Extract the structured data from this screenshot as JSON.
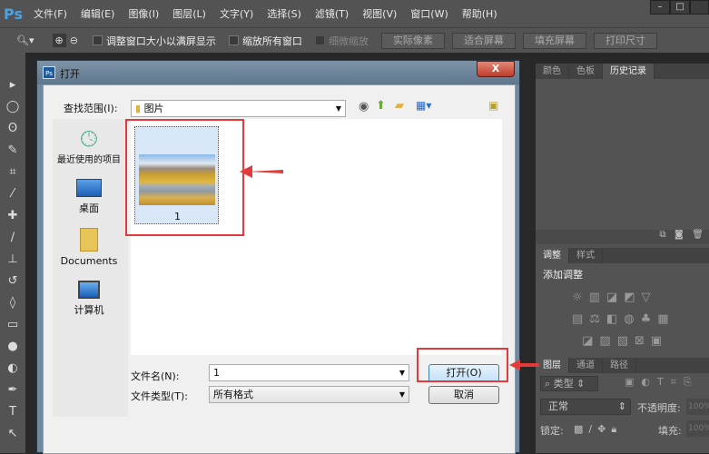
{
  "app": {
    "logo": "Ps",
    "menus": [
      "文件(F)",
      "编辑(E)",
      "图像(I)",
      "图层(L)",
      "文字(Y)",
      "选择(S)",
      "滤镜(T)",
      "视图(V)",
      "窗口(W)",
      "帮助(H)"
    ]
  },
  "options": {
    "resize_windows": "调整窗口大小以满屏显示",
    "zoom_all": "缩放所有窗口",
    "scrubby": "细微缩放",
    "actual_pixels": "实际像素",
    "fit_screen": "适合屏幕",
    "fill_screen": "填充屏幕",
    "print_size": "打印尺寸"
  },
  "panels": {
    "top_tabs": [
      "颜色",
      "色板",
      "历史记录"
    ],
    "adjust_tabs": [
      "调整",
      "样式"
    ],
    "add_adjustment": "添加调整",
    "layer_tabs": [
      "图层",
      "通道",
      "路径"
    ],
    "kind": "类型",
    "blend_mode": "正常",
    "opacity_label": "不透明度:",
    "opacity": "100%",
    "lock_label": "锁定:",
    "fill_label": "填充:",
    "fill": "100%"
  },
  "dialog": {
    "title": "打开",
    "look_in_label": "查找范围(I):",
    "look_in": "图片",
    "places": [
      "最近使用的项目",
      "桌面",
      "Documents",
      "计算机"
    ],
    "file_name": "1",
    "filename_label": "文件名(N):",
    "filename_value": "1",
    "filetype_label": "文件类型(T):",
    "filetype_value": "所有格式",
    "open_button": "打开(O)",
    "cancel_button": "取消",
    "close": "X"
  },
  "colors": {
    "highlight": "#e33b3b",
    "accent": "#4ba3e6"
  }
}
